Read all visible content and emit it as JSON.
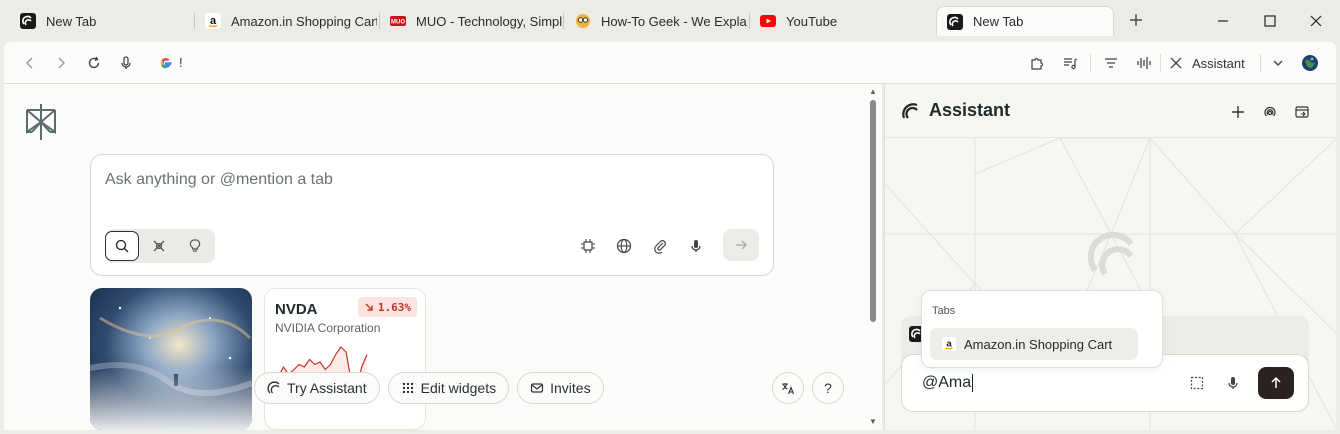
{
  "tabs": [
    {
      "label": "New Tab",
      "icon": "perplexity-icon"
    },
    {
      "label": "Amazon.in Shopping Cart",
      "icon": "amazon-icon"
    },
    {
      "label": "MUO - Technology, Simpl",
      "icon": "muo-icon"
    },
    {
      "label": "How-To Geek - We Explai",
      "icon": "howtogeek-icon"
    },
    {
      "label": "YouTube",
      "icon": "youtube-icon"
    },
    {
      "label": "New Tab",
      "icon": "perplexity-icon",
      "active": true
    }
  ],
  "toolbar": {
    "url": "!",
    "assistant_label": "Assistant"
  },
  "main": {
    "ask_placeholder": "Ask anything or @mention a tab",
    "stock": {
      "symbol": "NVDA",
      "change": "1.63%",
      "company": "NVIDIA Corporation",
      "direction": "down",
      "sparkline": [
        28,
        26,
        30,
        27,
        29,
        31,
        30,
        33,
        31,
        32,
        29,
        31,
        35,
        38,
        36,
        24,
        22,
        30,
        35
      ]
    },
    "pills": {
      "try_assistant": "Try Assistant",
      "edit_widgets": "Edit widgets",
      "invites": "Invites"
    },
    "help_label": "?"
  },
  "assistant": {
    "title": "Assistant",
    "popup_label": "Tabs",
    "popup_item": "Amazon.in Shopping Cart",
    "input_value": "@Ama"
  },
  "colors": {
    "background": "#ecebe6",
    "surface": "#fbfbf9",
    "stock_down": "#c2352b",
    "submit": "#2a2320"
  }
}
